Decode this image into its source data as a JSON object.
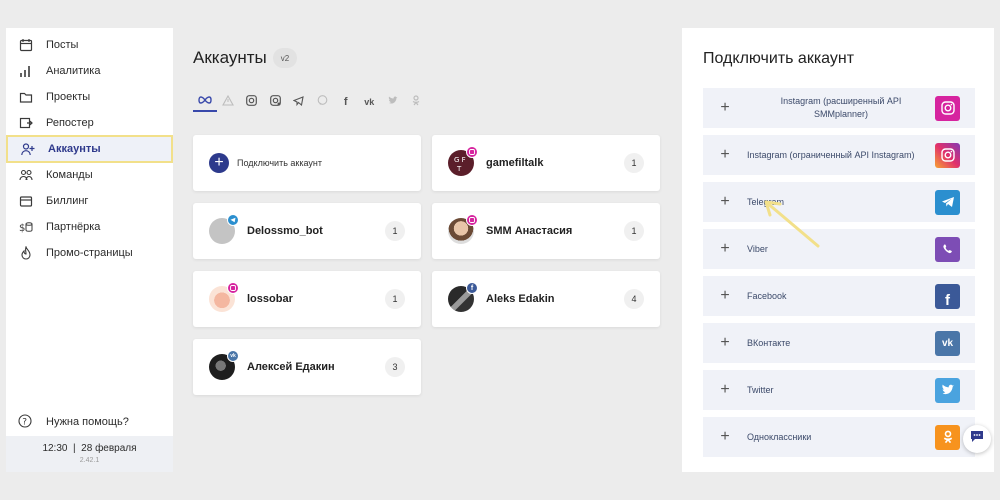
{
  "sidebar": {
    "items": [
      {
        "label": "Посты",
        "icon": "calendar-icon"
      },
      {
        "label": "Аналитика",
        "icon": "bar-chart-icon"
      },
      {
        "label": "Проекты",
        "icon": "folder-icon"
      },
      {
        "label": "Репостер",
        "icon": "repost-icon"
      },
      {
        "label": "Аккаунты",
        "icon": "add-user-icon",
        "active": true
      },
      {
        "label": "Команды",
        "icon": "team-icon"
      },
      {
        "label": "Биллинг",
        "icon": "wallet-icon"
      },
      {
        "label": "Партнёрка",
        "icon": "coins-icon"
      },
      {
        "label": "Промо-страницы",
        "icon": "flame-icon"
      }
    ],
    "help": "Нужна помощь?",
    "footer_time": "12:30  |  28 февраля",
    "footer_version": "2.42.1"
  },
  "main": {
    "title": "Аккаунты",
    "badge": "v2",
    "filters": [
      "all-networks-icon",
      "warning-icon",
      "instagram-icon",
      "instagram-api-icon",
      "telegram-icon",
      "viber-icon",
      "facebook-icon",
      "vk-icon",
      "twitter-icon",
      "odnoklassniki-icon"
    ],
    "add_account_label": "Подключить аккаунт",
    "accounts": [
      {
        "name": "gamefiltalk",
        "count": "1",
        "network": "instagram"
      },
      {
        "name": "Delossmo_bot",
        "count": "1",
        "network": "telegram"
      },
      {
        "name": "SMM Анастасия",
        "count": "1",
        "network": "instagram"
      },
      {
        "name": "lossobar",
        "count": "1",
        "network": "instagram"
      },
      {
        "name": "Aleks Edakin",
        "count": "4",
        "network": "facebook"
      },
      {
        "name": "Алексей Едакин",
        "count": "3",
        "network": "vk"
      }
    ]
  },
  "connect": {
    "title": "Подключить аккаунт",
    "items": [
      {
        "label": "Instagram (расширенный API SMMplanner)",
        "color": "#d6249f"
      },
      {
        "label": "Instagram (ограниченный API Instagram)",
        "color": "#e1306c"
      },
      {
        "label": "Telegram",
        "color": "#2b8fcf"
      },
      {
        "label": "Viber",
        "color": "#7d4db5"
      },
      {
        "label": "Facebook",
        "color": "#3b5998"
      },
      {
        "label": "ВКонтакте",
        "color": "#4a76a8"
      },
      {
        "label": "Twitter",
        "color": "#4aa3df"
      },
      {
        "label": "Одноклассники",
        "color": "#f7931e"
      }
    ]
  },
  "colors": {
    "accent": "#2f3a8c",
    "highlight": "#f2e08a"
  }
}
